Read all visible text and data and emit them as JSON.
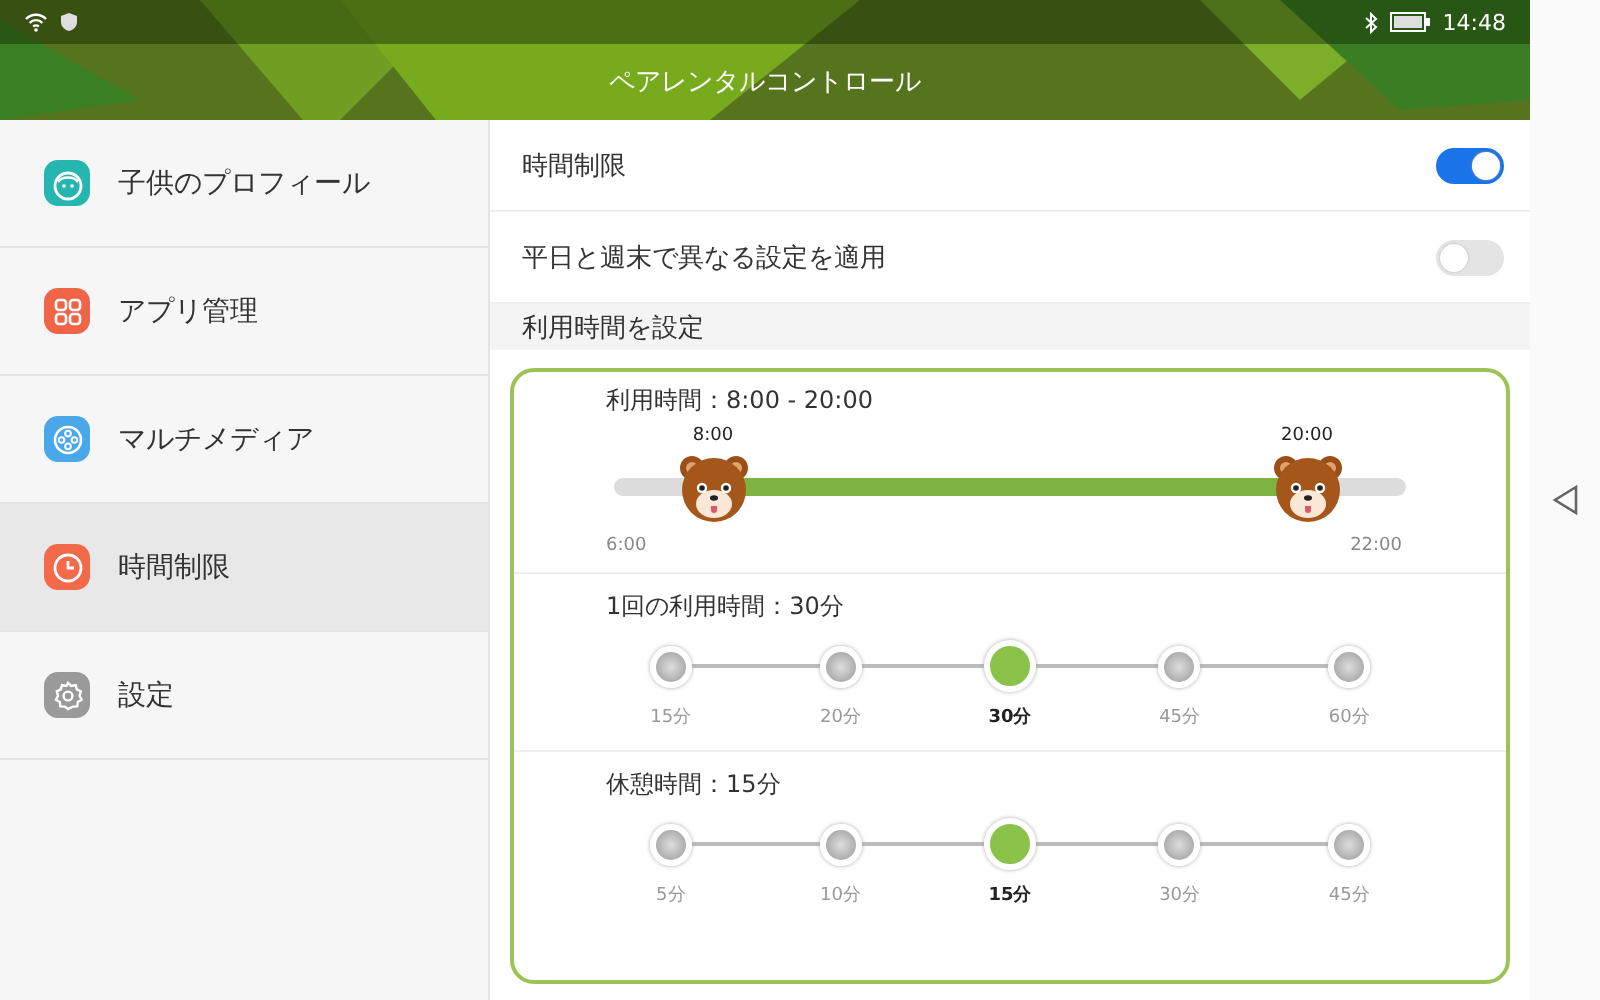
{
  "status_bar": {
    "time": "14:48"
  },
  "header": {
    "title": "ペアレンタルコントロール"
  },
  "sidebar": {
    "items": [
      {
        "label": "子供のプロフィール",
        "color": "#26b5b0",
        "selected": false
      },
      {
        "label": "アプリ管理",
        "color": "#f06448",
        "selected": false
      },
      {
        "label": "マルチメディア",
        "color": "#4aa8ea",
        "selected": false
      },
      {
        "label": "時間制限",
        "color": "#f26a4a",
        "selected": true
      },
      {
        "label": "設定",
        "color": "#9a9a9a",
        "selected": false
      }
    ]
  },
  "settings": [
    {
      "label": "時間制限",
      "on": true
    },
    {
      "label": "平日と週末で異なる設定を適用",
      "on": false
    }
  ],
  "section_title": "利用時間を設定",
  "card": {
    "range": {
      "title": "利用時間：8:00 - 20:00",
      "min_label": "6:00",
      "max_label": "22:00",
      "start": {
        "label": "8:00",
        "level": 0.125
      },
      "end": {
        "label": "20:00",
        "level": 0.875
      }
    },
    "steps": [
      {
        "title": "1回の利用時間：30分",
        "stops": [
          {
            "label": "15分",
            "selected": false
          },
          {
            "label": "20分",
            "selected": false
          },
          {
            "label": "30分",
            "selected": true
          },
          {
            "label": "45分",
            "selected": false
          },
          {
            "label": "60分",
            "selected": false
          }
        ]
      },
      {
        "title": "休憩時間：15分",
        "stops": [
          {
            "label": "5分",
            "selected": false
          },
          {
            "label": "10分",
            "selected": false
          },
          {
            "label": "15分",
            "selected": true
          },
          {
            "label": "30分",
            "selected": false
          },
          {
            "label": "45分",
            "selected": false
          }
        ]
      }
    ]
  }
}
